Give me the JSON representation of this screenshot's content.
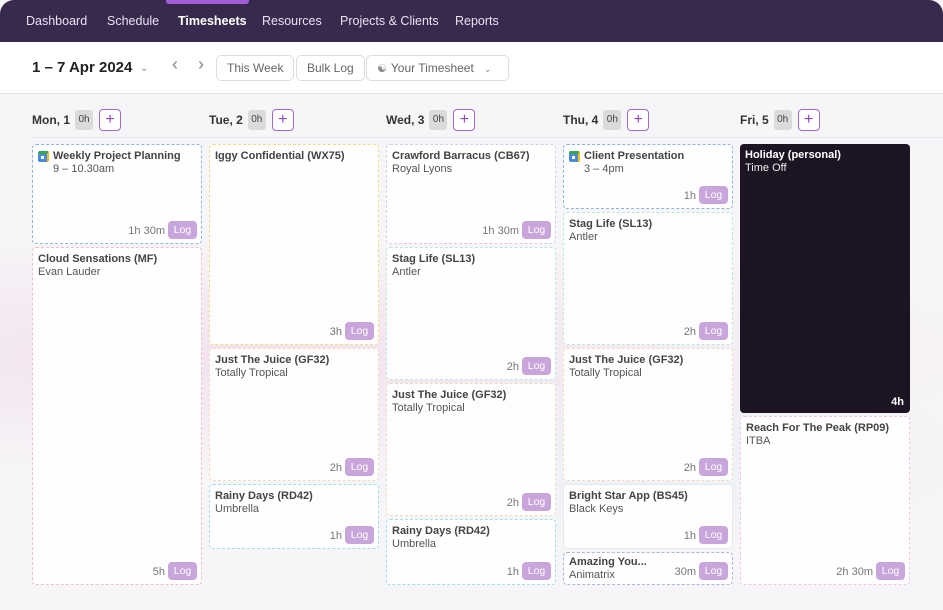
{
  "nav": {
    "items": [
      {
        "label": "Dashboard",
        "active": false
      },
      {
        "label": "Schedule",
        "active": false
      },
      {
        "label": "Timesheets",
        "active": true
      },
      {
        "label": "Resources",
        "active": false
      },
      {
        "label": "Projects & Clients",
        "active": false
      },
      {
        "label": "Reports",
        "active": false
      }
    ],
    "accent_color": "#a25ed6",
    "bg_color": "#382a4c"
  },
  "toolbar": {
    "date_range": "1 – 7 Apr 2024",
    "this_week_label": "This Week",
    "bulk_log_label": "Bulk Log",
    "timesheet_select_label": "Your Timesheet"
  },
  "days": [
    {
      "label": "Mon, 1",
      "hours": "0h"
    },
    {
      "label": "Tue, 2",
      "hours": "0h"
    },
    {
      "label": "Wed, 3",
      "hours": "0h"
    },
    {
      "label": "Thu, 4",
      "hours": "0h"
    },
    {
      "label": "Fri, 5",
      "hours": "0h"
    }
  ],
  "entries": {
    "mon": [
      {
        "title": "Weekly Project Planning",
        "subtitle": "9 – 10.30am",
        "duration": "1h 30m",
        "log": "Log",
        "calendar_event": true
      },
      {
        "title": "Cloud Sensations (MF)",
        "subtitle": "Evan Lauder",
        "duration": "5h",
        "log": "Log"
      }
    ],
    "tue": [
      {
        "title": "Iggy Confidential (WX75)",
        "subtitle": "",
        "duration": "3h",
        "log": "Log"
      },
      {
        "title": "Just The Juice (GF32)",
        "subtitle": "Totally Tropical",
        "duration": "2h",
        "log": "Log"
      },
      {
        "title": "Rainy Days (RD42)",
        "subtitle": "Umbrella",
        "duration": "1h",
        "log": "Log"
      }
    ],
    "wed": [
      {
        "title": "Crawford Barracus (CB67)",
        "subtitle": "Royal Lyons",
        "duration": "1h 30m",
        "log": "Log"
      },
      {
        "title": "Stag Life (SL13)",
        "subtitle": "Antler",
        "duration": "2h",
        "log": "Log"
      },
      {
        "title": "Just The Juice (GF32)",
        "subtitle": "Totally Tropical",
        "duration": "2h",
        "log": "Log"
      },
      {
        "title": "Rainy Days (RD42)",
        "subtitle": "Umbrella",
        "duration": "1h",
        "log": "Log"
      }
    ],
    "thu": [
      {
        "title": "Client Presentation",
        "subtitle": "3 – 4pm",
        "duration": "1h",
        "log": "Log",
        "calendar_event": true
      },
      {
        "title": "Stag Life (SL13)",
        "subtitle": "Antler",
        "duration": "2h",
        "log": "Log"
      },
      {
        "title": "Just The Juice (GF32)",
        "subtitle": "Totally Tropical",
        "duration": "2h",
        "log": "Log"
      },
      {
        "title": "Bright Star App (BS45)",
        "subtitle": "Black Keys",
        "duration": "1h",
        "log": "Log"
      },
      {
        "title": "Amazing You...",
        "subtitle": "Animatrix",
        "duration": "30m",
        "log": "Log"
      }
    ],
    "fri": [
      {
        "title": "Holiday (personal)",
        "subtitle": "Time Off",
        "duration": "4h",
        "time_off": true
      },
      {
        "title": "Reach For The Peak (RP09)",
        "subtitle": "ITBA",
        "duration": "2h 30m",
        "log": "Log"
      }
    ]
  },
  "colors": {
    "log_button": "#c8a6dc",
    "holiday_bg": "#1c1423",
    "border_blue": "#8fb4e3",
    "border_pink": "#f2bcc8",
    "border_yellow": "#f0dc86",
    "border_lilac": "#d9cbe8",
    "border_mint": "#bfe6dc",
    "border_peach": "#f2d9c2",
    "border_cyan": "#9fdfea",
    "border_periwinkle": "#a9b4ee"
  }
}
